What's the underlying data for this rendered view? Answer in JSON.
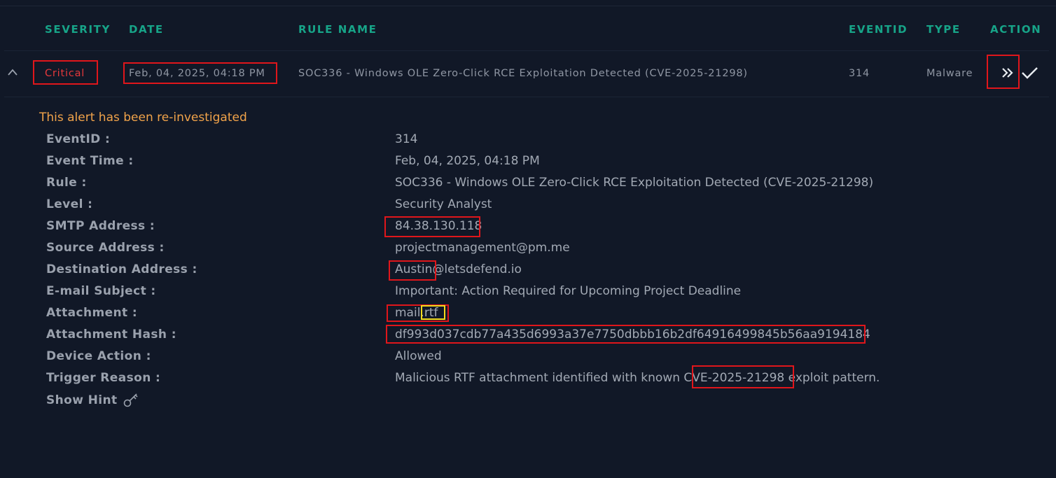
{
  "table": {
    "headers": {
      "severity": "SEVERITY",
      "date": "DATE",
      "rule_name": "RULE NAME",
      "eventid": "EVENTID",
      "type": "TYPE",
      "action": "ACTION"
    },
    "row": {
      "severity": "Critical",
      "date": "Feb, 04, 2025, 04:18 PM",
      "rule_name": "SOC336 - Windows OLE Zero-Click RCE Exploitation Detected (CVE-2025-21298)",
      "eventid": "314",
      "type": "Malware",
      "expand_icon": "chevron-up-icon",
      "actions": [
        "forward-icon",
        "check-icon"
      ]
    }
  },
  "details": {
    "notice": "This alert has been re-investigated",
    "fields": [
      {
        "label": "EventID :",
        "value": "314"
      },
      {
        "label": "Event Time :",
        "value": "Feb, 04, 2025, 04:18 PM"
      },
      {
        "label": "Rule :",
        "value": "SOC336 - Windows OLE Zero-Click RCE Exploitation Detected (CVE-2025-21298)"
      },
      {
        "label": "Level :",
        "value": "Security Analyst"
      },
      {
        "label": "SMTP Address :",
        "value": "84.38.130.118"
      },
      {
        "label": "Source Address :",
        "value": "projectmanagement@pm.me"
      },
      {
        "label": "Destination Address :",
        "value": "Austin@letsdefend.io"
      },
      {
        "label": "E-mail Subject :",
        "value": "Important: Action Required for Upcoming Project Deadline"
      },
      {
        "label": "Attachment :",
        "value": "mail.rtf"
      },
      {
        "label": "Attachment Hash :",
        "value": "df993d037cdb77a435d6993a37e7750dbbb16b2df64916499845b56aa9194184"
      },
      {
        "label": "Device Action :",
        "value": "Allowed"
      },
      {
        "label": "Trigger Reason :",
        "value": "Malicious RTF attachment identified with known CVE-2025-21298 exploit pattern."
      }
    ],
    "show_hint": "Show Hint",
    "hint_icon": "key-icon"
  },
  "colors": {
    "background": "#111827",
    "header_accent": "#17a488",
    "critical": "#e5383b",
    "notice": "#f1a34a",
    "annotation_red": "#e0161b",
    "annotation_yellow": "#f5d91c"
  }
}
